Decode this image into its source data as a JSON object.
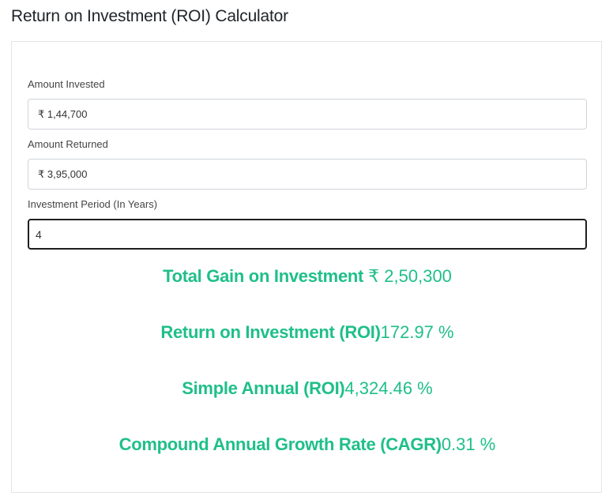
{
  "page": {
    "title": "Return on Investment (ROI) Calculator"
  },
  "form": {
    "amount_invested": {
      "label": "Amount Invested",
      "value": "₹ 1,44,700"
    },
    "amount_returned": {
      "label": "Amount Returned",
      "value": "₹ 3,95,000"
    },
    "investment_period": {
      "label": "Investment Period (In Years)",
      "value": "4"
    }
  },
  "results": {
    "total_gain": {
      "label": "Total Gain on Investment",
      "value": "₹ 2,50,300"
    },
    "roi": {
      "label": "Return on Investment (ROI)",
      "value": "172.97 %"
    },
    "simple_annual_roi": {
      "label": "Simple Annual (ROI)",
      "value": "4,324.46 %"
    },
    "cagr": {
      "label": "Compound Annual Growth Rate (CAGR)",
      "value": "0.31 %"
    }
  },
  "colors": {
    "result_accent": "#1fbf8a",
    "focused_border": "#1e1e1e",
    "input_border": "#d0d4d8"
  }
}
